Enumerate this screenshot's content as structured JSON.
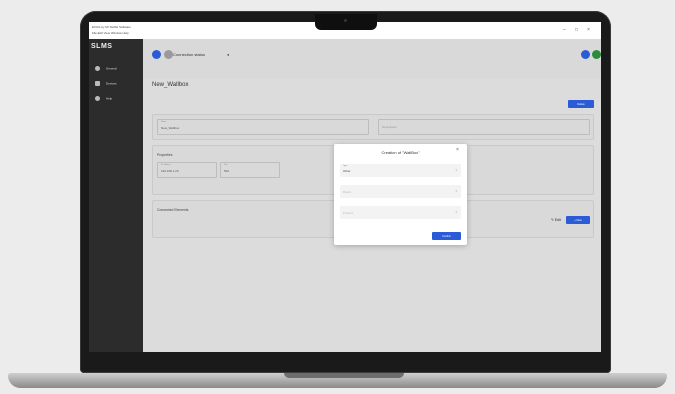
{
  "window": {
    "title": "EVCG by Mr Stoffel Software",
    "menu": "File  Edit  View  Window  Help",
    "min": "–",
    "max": "□",
    "close": "×"
  },
  "sidebar": {
    "logo": "SLMS",
    "items": [
      {
        "label": "General",
        "icon": "gear-icon"
      },
      {
        "label": "Devices",
        "icon": "grid-icon"
      },
      {
        "label": "Help",
        "icon": "help-icon"
      }
    ]
  },
  "header": {
    "breadcrumb": "Connection status",
    "status_dot": "●"
  },
  "page": {
    "title": "New_Wallbox",
    "action_button": "Delete"
  },
  "form": {
    "name_label": "Name",
    "name_value": "New_Wallbox",
    "description_placeholder": "Description",
    "properties_label": "Properties",
    "ip_label": "IP address",
    "ip_value": "192.168.1.20",
    "port_label": "Port",
    "port_value": "502",
    "extra_label": "Sensor data",
    "connected_label": "Connected Elements",
    "edit_button": "Edit",
    "add_button": "+ New"
  },
  "dialog": {
    "title": "Creation of \"WallBox\"",
    "close": "×",
    "type_label": "Type",
    "type_value": "Other",
    "brand_placeholder": "Brand",
    "product_placeholder": "Product",
    "confirm_button": "Confirm"
  },
  "colors": {
    "accent": "#2b5bd6",
    "green": "#2e8b3e",
    "sidebar": "#2c2c2c"
  }
}
